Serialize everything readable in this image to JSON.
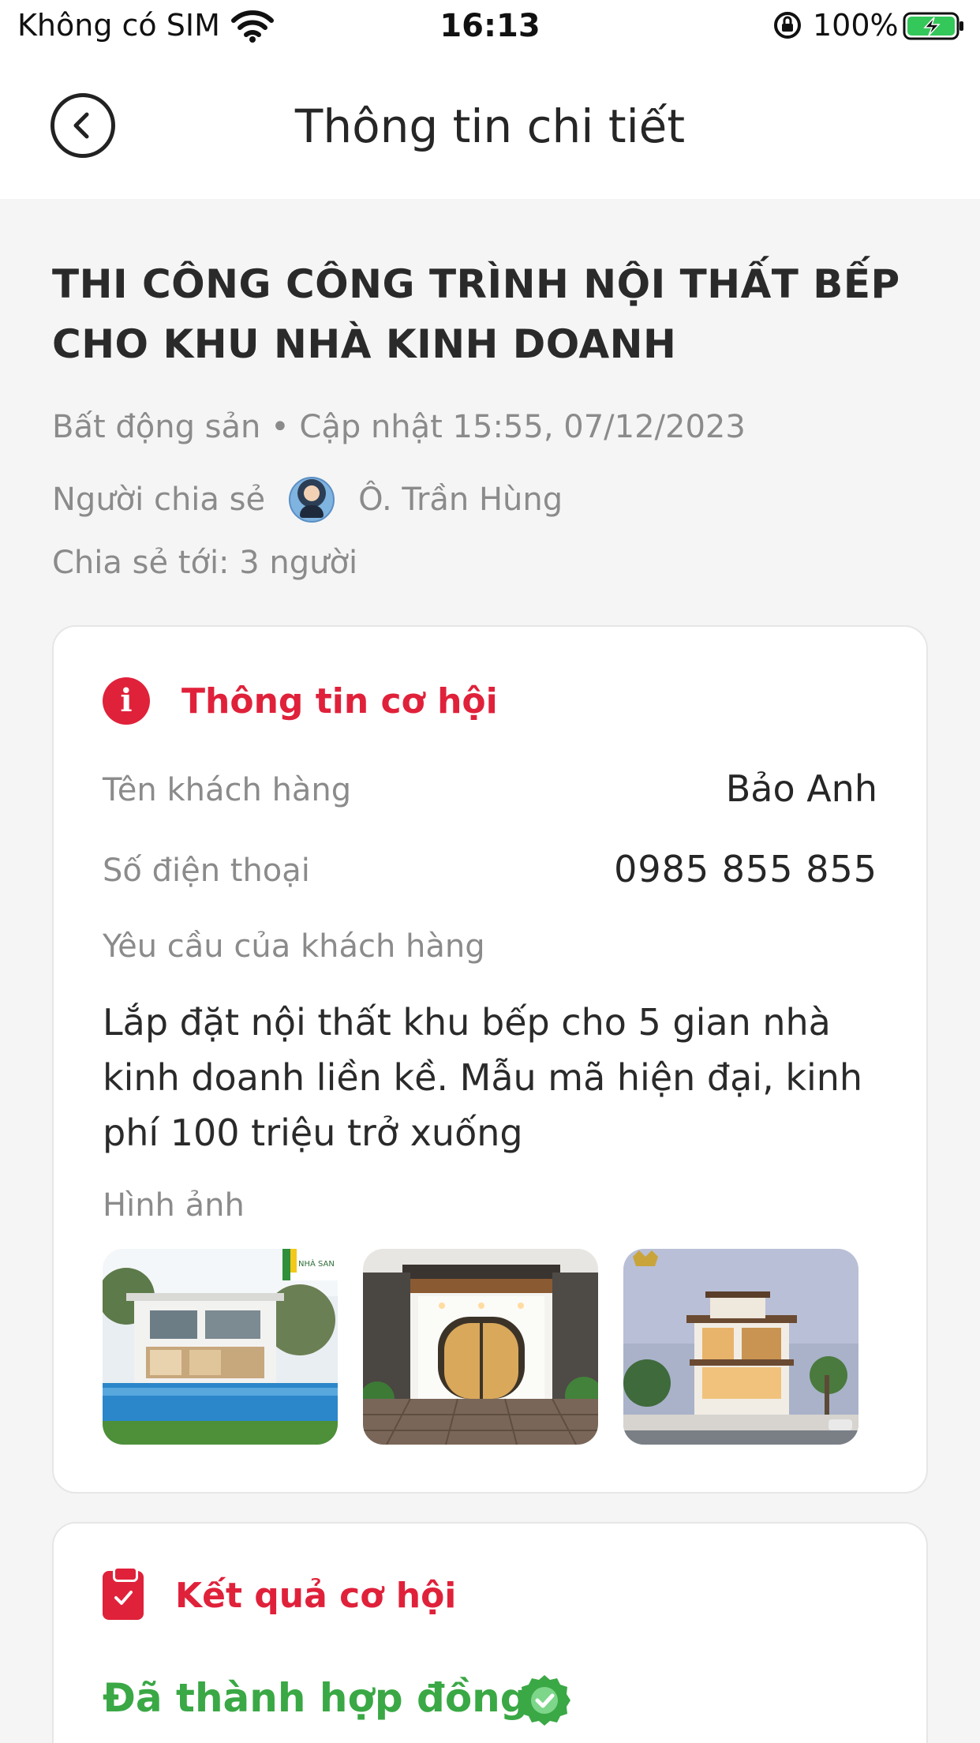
{
  "status_bar": {
    "carrier": "Không có SIM",
    "time": "16:13",
    "battery": "100%"
  },
  "header": {
    "title": "Thông tin chi tiết"
  },
  "job": {
    "title": "THI CÔNG CÔNG TRÌNH NỘI THẤT BẾP CHO KHU NHÀ KINH DOANH",
    "category_line": "Bất động sản • Cập nhật 15:55, 07/12/2023",
    "sharer_label": "Người chia sẻ",
    "sharer_name": "Ô. Trần Hùng",
    "shared_to": "Chia sẻ tới: 3 người"
  },
  "opportunity": {
    "heading": "Thông tin cơ hội",
    "customer_label": "Tên khách hàng",
    "customer_value": "Bảo Anh",
    "phone_label": "Số điện thoại",
    "phone_value": "0985 855 855",
    "request_label": "Yêu cầu của khách hàng",
    "request_value": "Lắp đặt nội thất khu bếp cho 5 gian nhà kinh doanh liền kề. Mẫu mã hiện đại, kinh phí 100 triệu trở xuống",
    "images_label": "Hình ảnh"
  },
  "result": {
    "heading": "Kết quả cơ hội",
    "status": "Đã thành hợp đồng"
  },
  "colors": {
    "accent_red": "#e0213a",
    "success_green": "#3aa845",
    "background": "#f5f5f5"
  }
}
